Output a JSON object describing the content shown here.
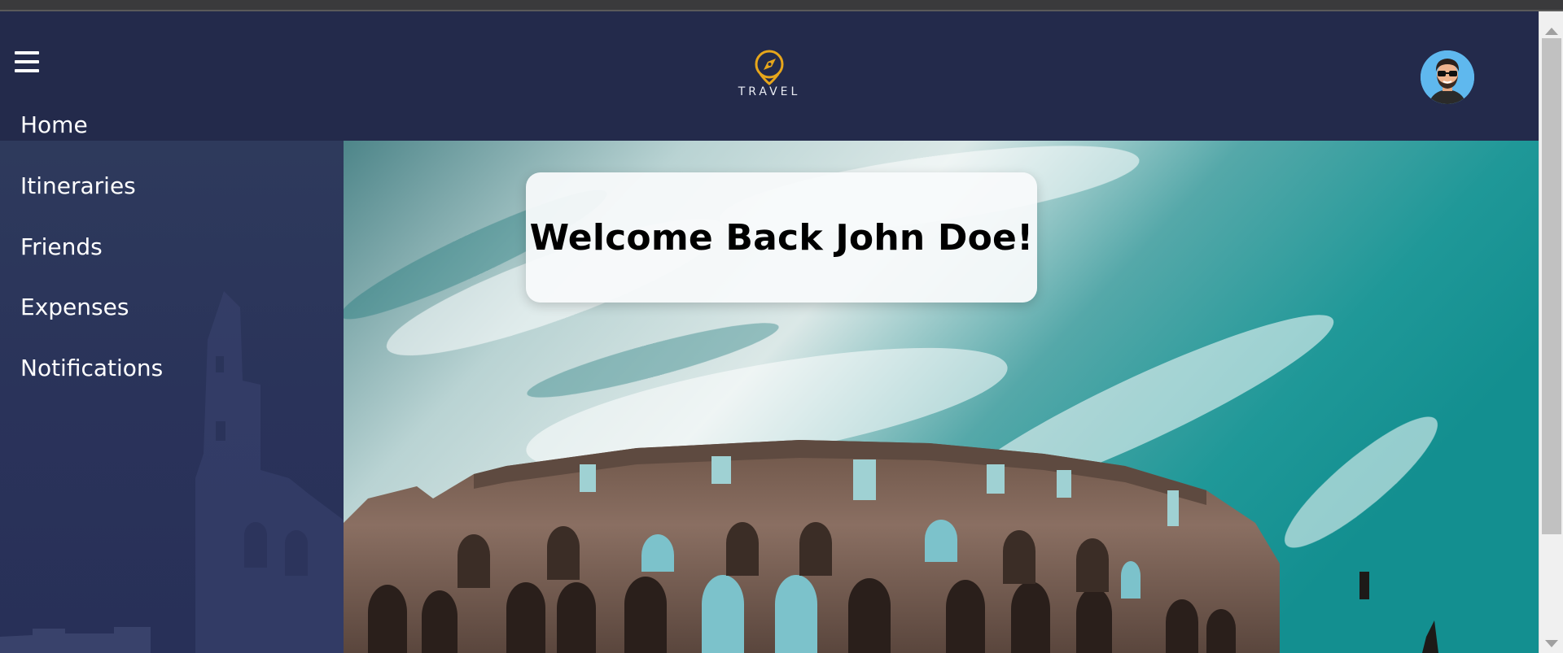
{
  "brand": {
    "logo_icon": "compass-pin-icon",
    "logo_text": "TRAVEL",
    "accent_color": "#e7a61b"
  },
  "header": {
    "menu_icon": "hamburger-menu-icon",
    "avatar_icon": "user-avatar-icon"
  },
  "sidebar": {
    "items": [
      {
        "label": "Home"
      },
      {
        "label": "Itineraries"
      },
      {
        "label": "Friends"
      },
      {
        "label": "Expenses"
      },
      {
        "label": "Notifications"
      }
    ]
  },
  "hero": {
    "welcome": "Welcome Back John Doe!",
    "image": "colosseum-photo"
  },
  "colors": {
    "header_bg": "#232a4b",
    "sidebar_bg": "#2b345a",
    "text": "#ffffff"
  }
}
